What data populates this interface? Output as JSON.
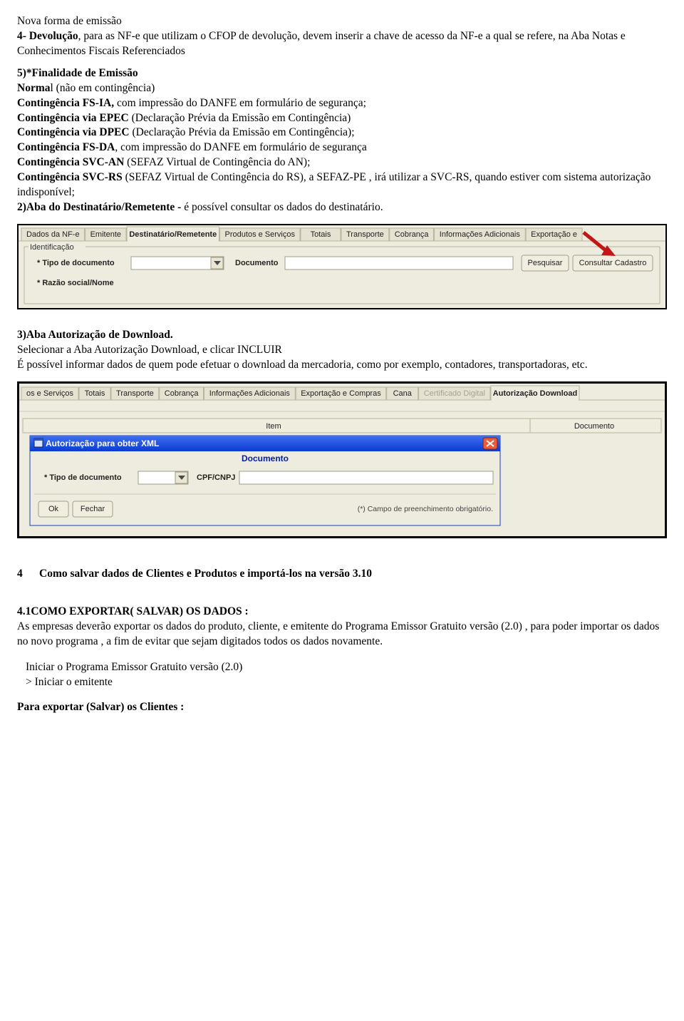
{
  "p1": {
    "l1": "Nova forma de emissão",
    "l2_bold": "4- Devolução",
    "l2_rest": ", para as NF-e que utilizam o CFOP de devolução, devem inserir a chave de acesso da NF-e a qual se refere, na Aba Notas e Conhecimentos Fiscais Referenciados"
  },
  "p2": {
    "a_bold": "5)*Finalidade de Emissão",
    "b_boldpre": "Norma",
    "b_rest": "l (não em contingência)",
    "c_bold": "Contingência FS-IA, ",
    "c_rest": "com impressão do DANFE em formulário de segurança;",
    "d_bold": "Contingência via EPEC ",
    "d_rest": "(Declaração Prévia da Emissão em Contingência)",
    "e_bold": "Contingência via DPEC ",
    "e_rest": "(Declaração Prévia da Emissão em Contingência);",
    "f_bold": "Contingência FS-DA",
    "f_rest": ", com impressão do DANFE em formulário de segurança",
    "g_bold": "Contingência SVC-AN ",
    "g_rest": "(SEFAZ Virtual de Contingência do AN);",
    "h_bold": "Contingência SVC-RS ",
    "h_rest": "(SEFAZ Virtual de Contingência do RS), a SEFAZ-PE , irá utilizar a SVC-RS, quando estiver com sistema autorização indisponível;",
    "i_bold": "2)Aba do Destinatário/Remetente - ",
    "i_rest": "é possível consultar os dados do destinatário."
  },
  "img1": {
    "tabs": [
      "Dados da NF-e",
      "Emitente",
      "Destinatário/Remetente",
      "Produtos e Serviços",
      "Totais",
      "Transporte",
      "Cobrança",
      "Informações Adicionais",
      "Exportação e"
    ],
    "activeIndex": 2,
    "group": "Identificação",
    "lblTipo": "* Tipo de documento",
    "lblDoc": "Documento",
    "lblRazao": "* Razão social/Nome",
    "btnPesquisar": "Pesquisar",
    "btnConsultar": "Consultar Cadastro"
  },
  "p3": {
    "a_bold": "3)Aba Autorização de Download.",
    "b": "Selecionar a Aba Autorização Download, e clicar INCLUIR",
    "c": "É possível informar dados de quem pode efetuar o download da mercadoria, como por exemplo, contadores, transportadoras, etc."
  },
  "img2": {
    "tabs": [
      "os e Serviços",
      "Totais",
      "Transporte",
      "Cobrança",
      "Informações Adicionais",
      "Exportação e Compras",
      "Cana",
      "Certificado Digital",
      "Autorização Download"
    ],
    "activeIndex": 8,
    "colItem": "Item",
    "colDoc": "Documento",
    "dlgTitle": "Autorização para obter XML",
    "dlgHead": "Documento",
    "lblTipo": "* Tipo de documento",
    "lblCpf": "CPF/CNPJ",
    "btnOk": "Ok",
    "btnFechar": "Fechar",
    "reqNote": "(*) Campo de preenchimento obrigatório."
  },
  "p4": {
    "num": "4",
    "title": "Como salvar dados de Clientes e Produtos e importá-los na versão 3.10"
  },
  "p5": {
    "head": "4.1COMO EXPORTAR( SALVAR) OS DADOS :",
    "body": "As empresas deverão exportar os dados do produto, cliente, e emitente do Programa Emissor Gratuito versão (2.0) , para poder importar os dados no novo programa , a fim de evitar que sejam digitados todos os dados novamente."
  },
  "p6": {
    "a": "Iniciar o Programa Emissor Gratuito versão (2.0)",
    "b": "> Iniciar o emitente"
  },
  "p7": "Para exportar (Salvar) os Clientes :"
}
